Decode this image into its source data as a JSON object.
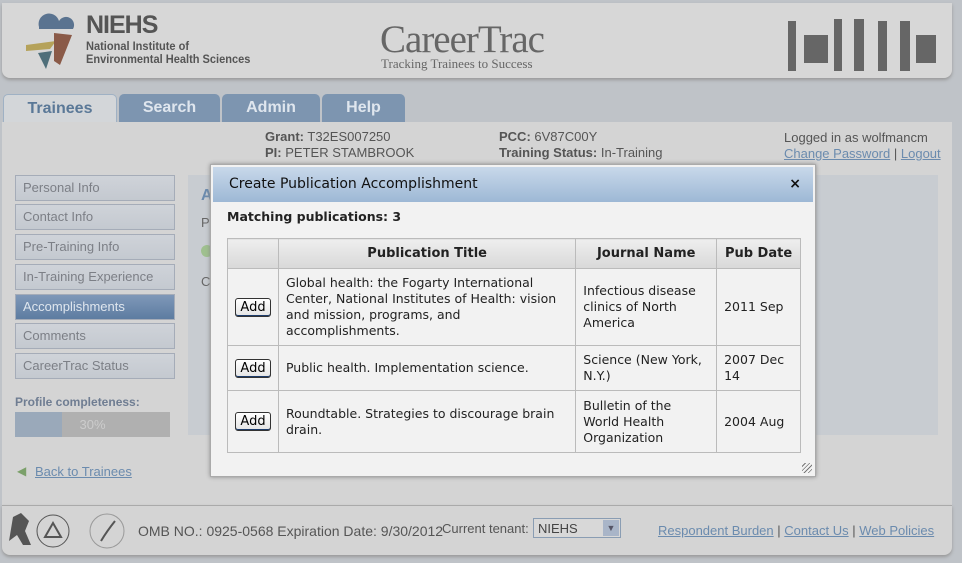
{
  "header": {
    "org_short": "NIEHS",
    "org_line1": "National Institute of",
    "org_line2": "Environmental Health Sciences",
    "app_name": "CareerTrac",
    "tagline": "Tracking Trainees to Success"
  },
  "tabs": [
    {
      "label": "Trainees",
      "active": true
    },
    {
      "label": "Search"
    },
    {
      "label": "Admin"
    },
    {
      "label": "Help"
    }
  ],
  "trainee": {
    "grant_label": "Grant:",
    "grant": "T32ES007250",
    "pi_label": "PI:",
    "pi": "PETER STAMBROOK",
    "pcc_label": "PCC:",
    "pcc": "6V87C00Y",
    "status_label": "Training Status:",
    "status": "In-Training"
  },
  "user": {
    "logged_in": "Logged in as wolfmancm",
    "change_password": "Change Password",
    "sep": "|",
    "logout": "Logout"
  },
  "sidebar": {
    "items": [
      {
        "label": "Personal Info"
      },
      {
        "label": "Contact Info"
      },
      {
        "label": "Pre-Training Info"
      },
      {
        "label": "In-Training Experience"
      },
      {
        "label": "Accomplishments",
        "active": true
      },
      {
        "label": "Comments"
      },
      {
        "label": "CareerTrac Status"
      }
    ],
    "profile_label": "Profile completeness:",
    "profile_percent": 30,
    "profile_text": "30%",
    "back_link": "Back to Trainees"
  },
  "main_partial": {
    "a": "A",
    "p": "P",
    "c": "C"
  },
  "modal": {
    "title": "Create Publication Accomplishment",
    "close": "×",
    "matching": "Matching publications: 3",
    "columns": [
      "",
      "Publication Title",
      "Journal Name",
      "Pub Date"
    ],
    "rows": [
      {
        "action": "Add",
        "title": "Global health: the Fogarty International Center, National Institutes of Health: vision and mission, programs, and accomplishments.",
        "journal": "Infectious disease clinics of North America",
        "date": "2011 Sep"
      },
      {
        "action": "Add",
        "title": "Public health. Implementation science.",
        "journal": "Science (New York, N.Y.)",
        "date": "2007 Dec 14"
      },
      {
        "action": "Add",
        "title": "Roundtable. Strategies to discourage brain drain.",
        "journal": "Bulletin of the World Health Organization",
        "date": "2004 Aug"
      }
    ]
  },
  "footer": {
    "omb": "OMB NO.: 0925-0568 Expiration Date: 9/30/2012",
    "tenant_label": "Current tenant:",
    "tenant": "NIEHS",
    "links": [
      "Respondent Burden",
      "Contact Us",
      "Web Policies"
    ],
    "sep": "|"
  }
}
